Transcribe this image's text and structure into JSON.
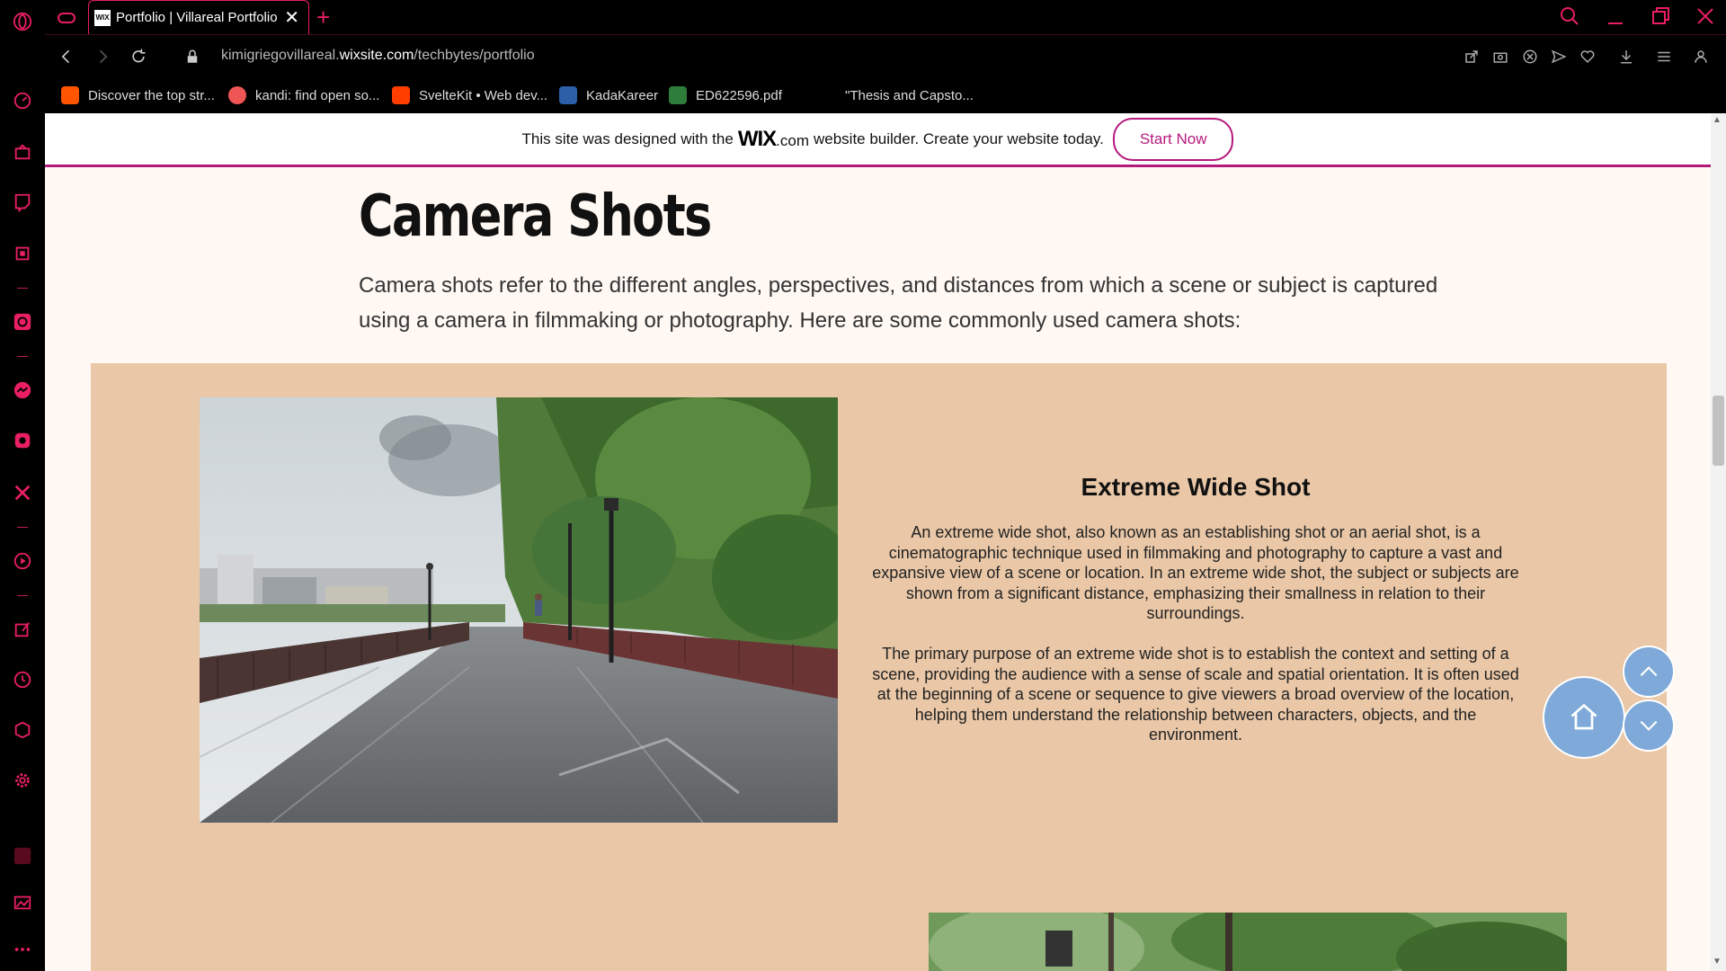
{
  "browser": {
    "tab": {
      "favicon": "WIX",
      "title": "Portfolio | Villareal Portfolio"
    },
    "url": {
      "prefix": "kimigriegovillareal.",
      "domain": "wixsite.com",
      "path": "/techbytes/portfolio"
    },
    "bookmarks": [
      {
        "label": "Discover the top str...",
        "color": "#ff5500",
        "icon": "soundcloud-icon"
      },
      {
        "label": "kandi: find open so...",
        "color": "#e55",
        "icon": "kandi-icon"
      },
      {
        "label": "SvelteKit • Web dev...",
        "color": "#ff3e00",
        "icon": "svelte-icon"
      },
      {
        "label": "KadaKareer",
        "color": "#2b5fa8",
        "icon": "kadakareer-icon"
      },
      {
        "label": "ED622596.pdf",
        "color": "#2f7d3a",
        "icon": "pdf-icon"
      },
      {
        "label": "\"Thesis and Capsto...",
        "color": "#000",
        "icon": "blank-icon"
      }
    ],
    "accent": "#e91e63"
  },
  "wix_banner": {
    "text_before": "This site was designed with the",
    "logo": "WIX",
    "logo_suffix": ".com",
    "text_after": "website builder. Create your website today.",
    "button": "Start Now"
  },
  "page": {
    "title": "Camera Shots",
    "intro": "Camera shots refer to the different angles, perspectives, and distances from which a scene or subject is captured using a camera in filmmaking or photography. Here are some commonly used camera shots:",
    "shot": {
      "title": "Extreme Wide Shot",
      "paragraph1": "An extreme wide shot, also known as an establishing shot or an aerial shot, is a cinematographic technique used in filmmaking and photography to capture a vast and expansive view of a scene or location. In an extreme wide shot, the subject or subjects are shown from a significant distance, emphasizing their smallness in relation to their surroundings.",
      "paragraph2": "The primary purpose of an extreme wide shot is to establish the context and setting of a scene, providing the audience with a sense of scale and spatial orientation. It is often used at the beginning of a scene or sequence to give viewers a broad overview of the location, helping them understand the relationship between characters, objects, and the environment."
    },
    "tan_color": "#e9c7a7",
    "nav_button_color": "#7ea9d8"
  }
}
